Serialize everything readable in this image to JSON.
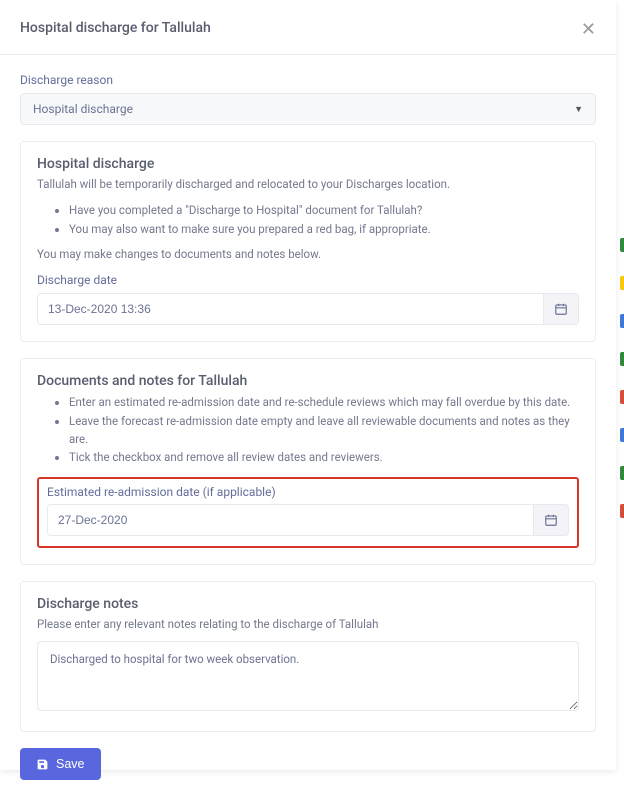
{
  "header": {
    "title": "Hospital discharge for Tallulah"
  },
  "reason": {
    "label": "Discharge reason",
    "value": "Hospital discharge"
  },
  "hospital_card": {
    "title": "Hospital discharge",
    "subtitle": "Tallulah will be temporarily discharged and relocated to your Discharges location.",
    "bullets": [
      "Have you completed a \"Discharge to Hospital\" document for Tallulah?",
      "You may also want to make sure you prepared a red bag, if appropriate."
    ],
    "footer_note": "You may make changes to documents and notes below.",
    "date_label": "Discharge date",
    "date_value": "13-Dec-2020 13:36"
  },
  "docs_card": {
    "title": "Documents and notes for Tallulah",
    "bullets": [
      "Enter an estimated re-admission date and re-schedule reviews which may fall overdue by this date.",
      "Leave the forecast re-admission date empty and leave all reviewable documents and notes as they are.",
      "Tick the checkbox and remove all review dates and reviewers."
    ],
    "readmit_label": "Estimated re-admission date (if applicable)",
    "readmit_value": "27-Dec-2020"
  },
  "notes_card": {
    "title": "Discharge notes",
    "subtitle": "Please enter any relevant notes relating to the discharge of Tallulah",
    "value": "Discharged to hospital for two week observation."
  },
  "buttons": {
    "save": "Save"
  },
  "edge_colors": [
    "#2e8b3d",
    "#f9c80e",
    "#3d79d6",
    "#2e8b3d",
    "#d34d3a",
    "#3d79d6",
    "#2e8b3d",
    "#d34d3a"
  ]
}
